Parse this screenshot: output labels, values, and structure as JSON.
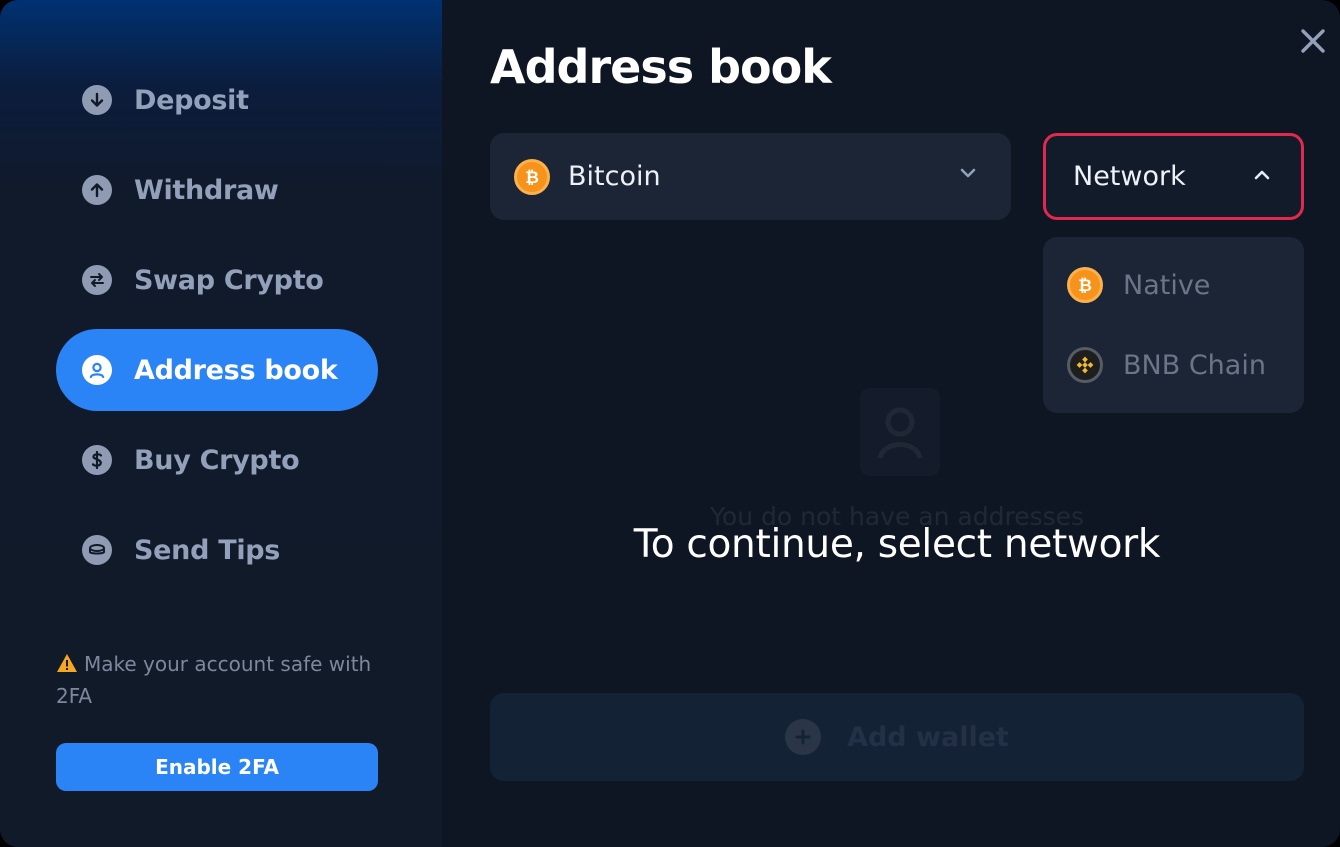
{
  "modal": {
    "title": "Address book",
    "close_icon": "close-icon"
  },
  "sidebar": {
    "items": [
      {
        "label": "Deposit",
        "icon": "arrow-down-circle-icon",
        "active": false
      },
      {
        "label": "Withdraw",
        "icon": "arrow-up-circle-icon",
        "active": false
      },
      {
        "label": "Swap Crypto",
        "icon": "swap-circle-icon",
        "active": false
      },
      {
        "label": "Address book",
        "icon": "user-circle-icon",
        "active": true
      },
      {
        "label": "Buy Crypto",
        "icon": "dollar-circle-icon",
        "active": false
      },
      {
        "label": "Send Tips",
        "icon": "coins-circle-icon",
        "active": false
      }
    ],
    "security_note": "Make your account safe with 2FA",
    "enable_2fa_label": "Enable 2FA"
  },
  "coin_select": {
    "value": "Bitcoin",
    "icon": "bitcoin-icon"
  },
  "network_select": {
    "label": "Network",
    "open": true,
    "options": [
      {
        "label": "Native",
        "icon": "bitcoin-icon"
      },
      {
        "label": "BNB Chain",
        "icon": "bnb-chain-icon"
      }
    ]
  },
  "empty_state": {
    "text": "You do not have an addresses",
    "icon": "address-book-icon"
  },
  "overlay_message": "To continue, select network",
  "add_wallet_label": "Add wallet",
  "colors": {
    "accent": "#2b84f5",
    "error_border": "#e0294d",
    "bitcoin": "#f7931a",
    "warning": "#f5a623"
  }
}
